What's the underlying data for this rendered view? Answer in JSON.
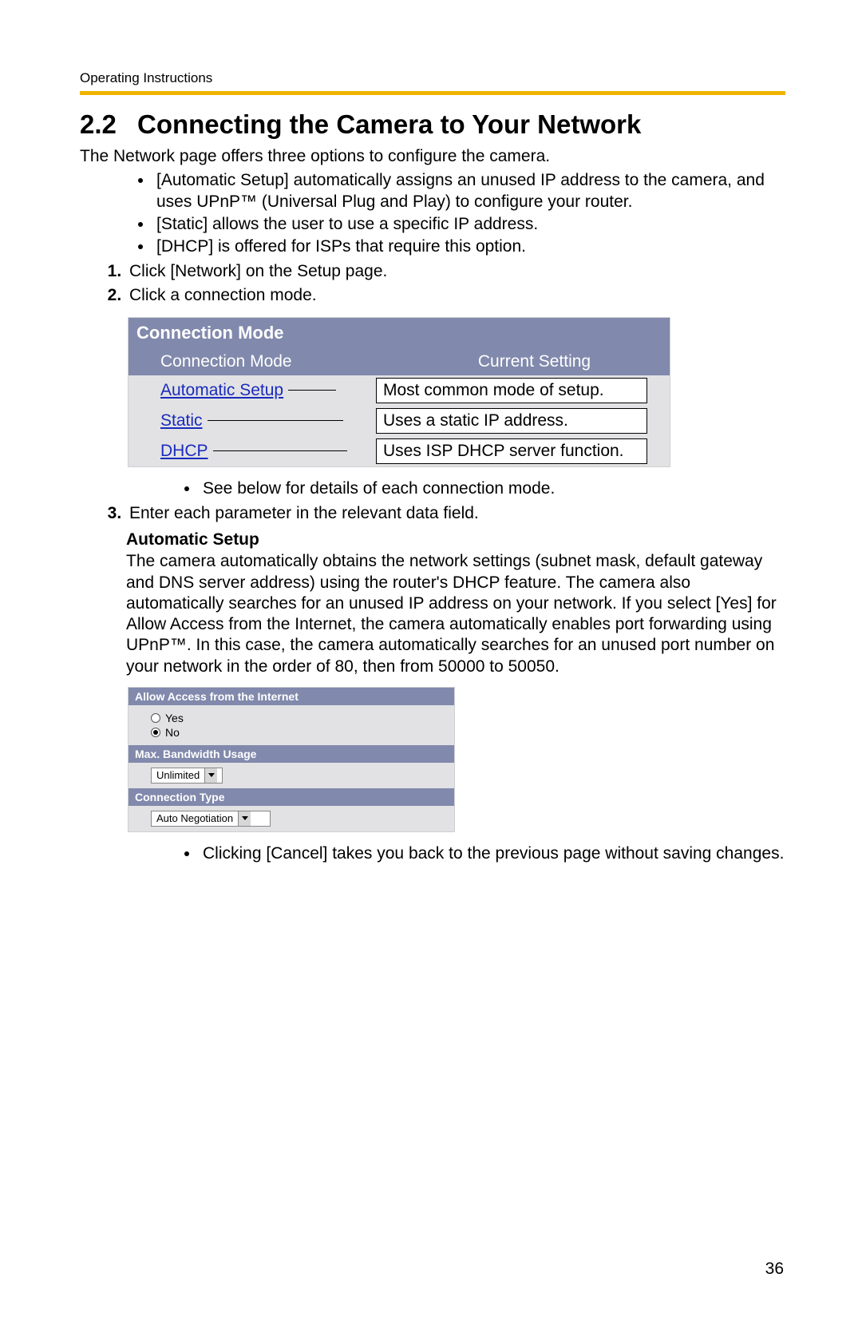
{
  "running_head": "Operating Instructions",
  "section_number": "2.2",
  "section_title": "Connecting the Camera to Your Network",
  "intro": "The Network page offers three options to configure the camera.",
  "bullets_top": [
    "[Automatic Setup] automatically assigns an unused IP address to the camera, and uses UPnP™ (Universal Plug and Play) to configure your router.",
    "[Static] allows the user to use a specific IP address.",
    "[DHCP] is offered for ISPs that require this option."
  ],
  "step1": "Click [Network] on the Setup page.",
  "step2": "Click a connection mode.",
  "conn_mode": {
    "title": "Connection Mode",
    "head_left": "Connection Mode",
    "head_right": "Current Setting",
    "rows": [
      {
        "link": "Automatic Setup",
        "desc": "Most common mode of setup."
      },
      {
        "link": "Static",
        "desc": "Uses a static IP address."
      },
      {
        "link": "DHCP",
        "desc": "Uses ISP DHCP server function."
      }
    ]
  },
  "step2_note": "See below for details of each connection mode.",
  "step3": "Enter each parameter in the relevant data field.",
  "auto_setup_heading": "Automatic Setup",
  "auto_setup_para": "The camera automatically obtains the network settings (subnet mask, default gateway and DNS server address) using the router's DHCP feature. The camera also automatically searches for an unused IP address on your network. If you select [Yes] for Allow Access from the Internet, the camera automatically enables port forwarding using UPnP™. In this case, the camera automatically searches for an unused port number on your network in the order of 80, then from 50000 to 50050.",
  "settings": {
    "allow_access_head": "Allow Access from the Internet",
    "yes_label": "Yes",
    "no_label": "No",
    "bandwidth_head": "Max. Bandwidth Usage",
    "bandwidth_value": "Unlimited",
    "conn_type_head": "Connection Type",
    "conn_type_value": "Auto Negotiation"
  },
  "cancel_note": "Clicking [Cancel] takes you back to the previous page without saving changes.",
  "page_number": "36"
}
